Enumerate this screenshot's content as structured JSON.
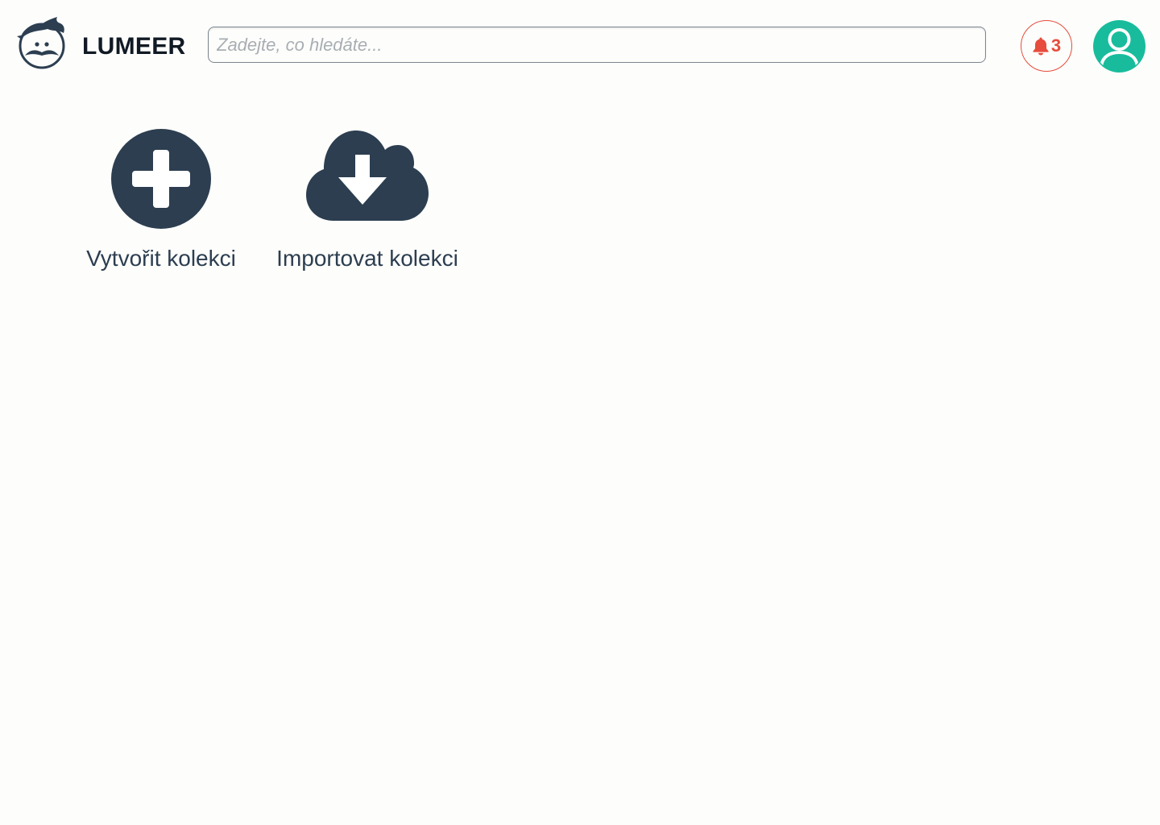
{
  "app": {
    "name": "LUMEER",
    "logo_icon": "lumeer-mustache-face-icon"
  },
  "search": {
    "placeholder": "Zadejte, co hledáte...",
    "value": ""
  },
  "notifications": {
    "icon": "bell-icon",
    "count": "3",
    "color": "#e74c3c"
  },
  "user": {
    "icon": "user-avatar-icon",
    "color": "#18bc9c"
  },
  "actions": [
    {
      "label": "Vytvořit kolekci",
      "icon": "plus-circle-icon"
    },
    {
      "label": "Importovat kolekci",
      "icon": "cloud-download-icon"
    }
  ],
  "colors": {
    "primary": "#2c3e50",
    "background": "#fdfdfb"
  }
}
